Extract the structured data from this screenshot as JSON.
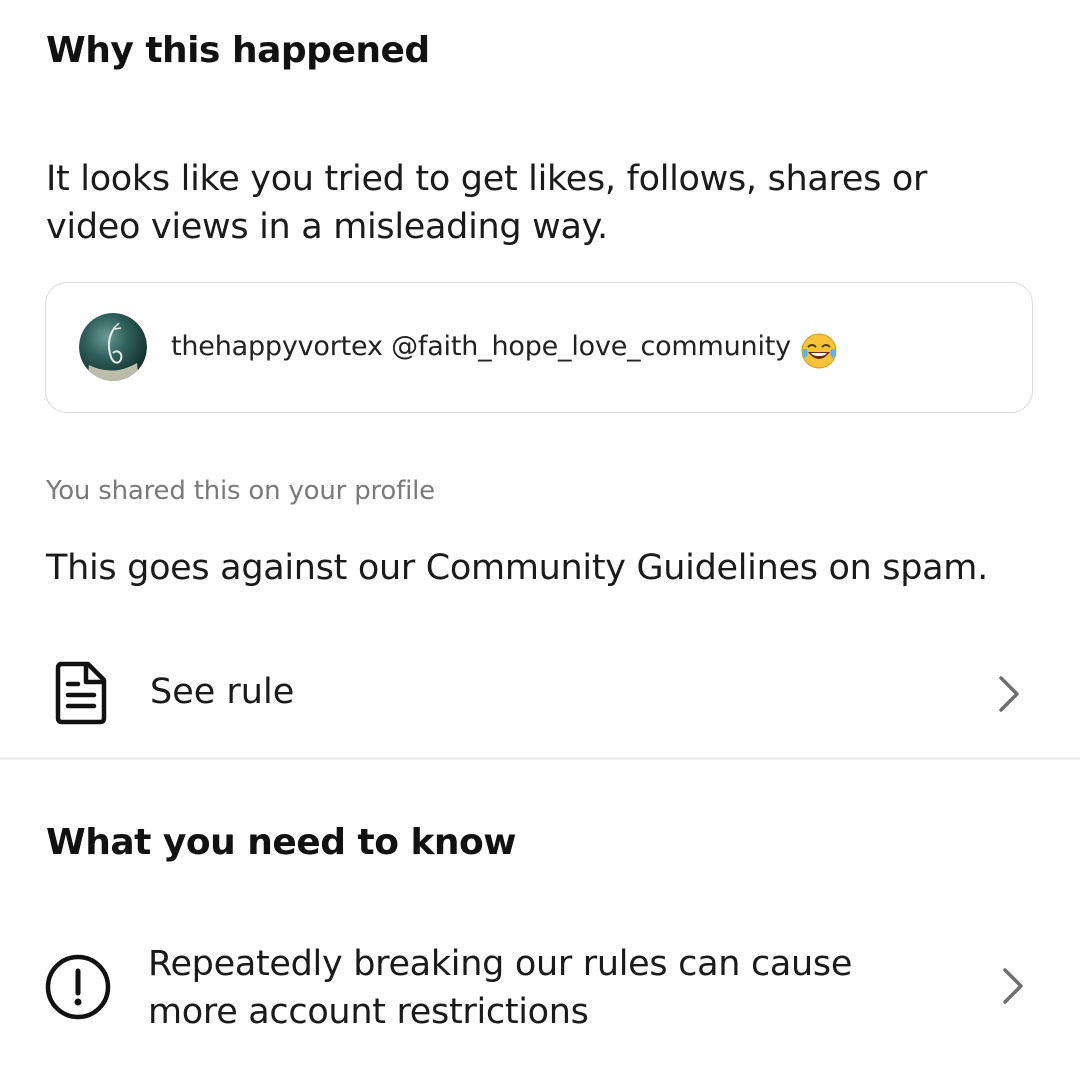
{
  "sections": {
    "why": {
      "heading": "Why this happened",
      "explanation": "It looks like you tried to get likes, follows, shares or video views in a misleading way."
    },
    "post": {
      "caption": "thehappyvortex @faith_hope_love_community",
      "emoji_icon": "face-with-tears-of-joy-icon"
    },
    "shared_note": "You shared this on your profile",
    "guideline_text": "This goes against our Community Guidelines on spam.",
    "see_rule": {
      "label": "See rule",
      "icon": "document-icon"
    },
    "know": {
      "heading": "What you need to know",
      "items": [
        {
          "text": "Repeatedly breaking our rules can cause more account restrictions",
          "icon": "alert-circle-icon"
        }
      ]
    }
  },
  "colors": {
    "text_primary": "#111111",
    "text_secondary": "#7a7a7a",
    "border": "#dadada",
    "divider": "#eeeeee",
    "chevron": "#6e6e6e"
  }
}
